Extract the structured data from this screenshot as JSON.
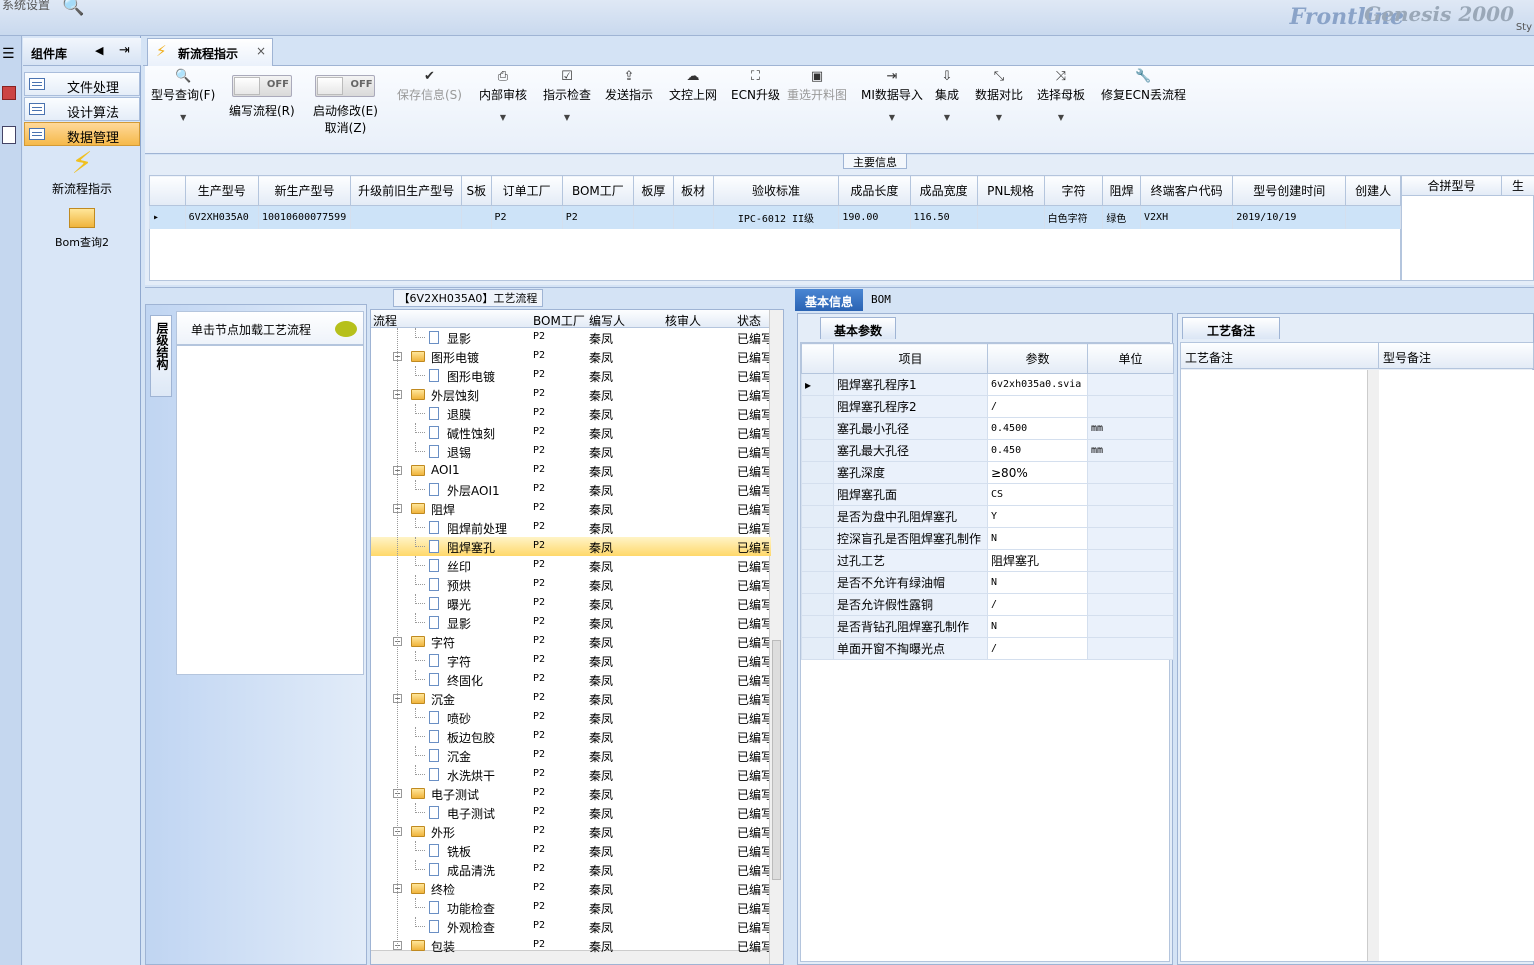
{
  "app": {
    "brand": "Frontline",
    "brand2": "Genesis 2000",
    "topleft": "系统设置",
    "topright": "Sty"
  },
  "complib": {
    "title": "组件库",
    "nav": [
      {
        "label": "文件处理",
        "active": false
      },
      {
        "label": "设计算法",
        "active": false
      },
      {
        "label": "数据管理",
        "active": true
      }
    ],
    "items": [
      {
        "label": "新流程指示",
        "icon": "lightning-icon"
      },
      {
        "label": "Bom查询2",
        "icon": "folder-open-icon"
      }
    ]
  },
  "tab": {
    "label": "新流程指示",
    "close": "×"
  },
  "toolbar": {
    "items": [
      {
        "label": "型号查询(F)",
        "icon": "🔍",
        "dd": true,
        "name": "model-query-button"
      },
      {
        "label": "编写流程(R)",
        "toggle": "OFF",
        "name": "write-flow-toggle"
      },
      {
        "label": "启动修改(E)",
        "label2": "取消(Z)",
        "toggle": "OFF",
        "name": "enable-edit-toggle"
      },
      {
        "label": "保存信息(S)",
        "icon": "✔",
        "disabled": true,
        "name": "save-info-button"
      },
      {
        "label": "内部审核",
        "icon": "⎙",
        "dd": true,
        "name": "internal-review-button"
      },
      {
        "label": "指示检查",
        "icon": "☑",
        "dd": true,
        "name": "instruction-check-button"
      },
      {
        "label": "发送指示",
        "icon": "⇪",
        "name": "send-instruction-button"
      },
      {
        "label": "文控上网",
        "icon": "☁",
        "name": "doc-control-online-button"
      },
      {
        "label": "ECN升级",
        "icon": "⛶",
        "name": "ecn-upgrade-button"
      },
      {
        "label": "重选开料图",
        "icon": "▣",
        "disabled": true,
        "name": "reselect-cutting-button"
      },
      {
        "label": "MI数据导入",
        "icon": "⇥",
        "dd": true,
        "name": "mi-import-button"
      },
      {
        "label": "集成",
        "icon": "⇩",
        "dd": true,
        "name": "integrate-button"
      },
      {
        "label": "数据对比",
        "icon": "⤡",
        "dd": true,
        "name": "data-compare-button"
      },
      {
        "label": "选择母板",
        "icon": "⤨",
        "dd": true,
        "name": "select-motherboard-button"
      },
      {
        "label": "修复ECN丢流程",
        "icon": "🔧",
        "name": "repair-ecn-button"
      }
    ]
  },
  "maininfo": {
    "caption": "主要信息",
    "columns": [
      "生产型号",
      "新生产型号",
      "升级前旧生产型号",
      "S板",
      "订单工厂",
      "BOM工厂",
      "板厚",
      "板材",
      "验收标准",
      "成品长度",
      "成品宽度",
      "PNL规格",
      "字符",
      "阻焊",
      "终端客户代码",
      "型号创建时间",
      "创建人"
    ],
    "row": [
      "6V2XH035A0",
      "10010600077599",
      "",
      "",
      "P2",
      "P2",
      "",
      "",
      "IPC-6012 II级",
      "190.00",
      "116.50",
      "",
      "白色字符",
      "绿色",
      "V2XH",
      "2019/10/19",
      ""
    ],
    "right_columns": [
      "合拼型号",
      "生"
    ]
  },
  "leftpanel": {
    "sidetab": "层级结构",
    "load_label": "单击节点加载工艺流程"
  },
  "tree": {
    "caption": "【6V2XH035A0】工艺流程",
    "columns": [
      "流程",
      "BOM工厂",
      "编写人",
      "核审人",
      "状态"
    ],
    "rows": [
      {
        "level": 2,
        "name": "显影",
        "f": "P2",
        "w": "秦凤",
        "s": "已编写"
      },
      {
        "level": 1,
        "name": "图形电镀",
        "f": "P2",
        "w": "秦凤",
        "s": "已编写"
      },
      {
        "level": 2,
        "name": "图形电镀",
        "f": "P2",
        "w": "秦凤",
        "s": "已编写"
      },
      {
        "level": 1,
        "name": "外层蚀刻",
        "f": "P2",
        "w": "秦凤",
        "s": "已编写"
      },
      {
        "level": 2,
        "name": "退膜",
        "f": "P2",
        "w": "秦凤",
        "s": "已编写"
      },
      {
        "level": 2,
        "name": "碱性蚀刻",
        "f": "P2",
        "w": "秦凤",
        "s": "已编写"
      },
      {
        "level": 2,
        "name": "退锡",
        "f": "P2",
        "w": "秦凤",
        "s": "已编写"
      },
      {
        "level": 1,
        "name": "AOI1",
        "f": "P2",
        "w": "秦凤",
        "s": "已编写"
      },
      {
        "level": 2,
        "name": "外层AOI1",
        "f": "P2",
        "w": "秦凤",
        "s": "已编写"
      },
      {
        "level": 1,
        "name": "阻焊",
        "f": "P2",
        "w": "秦凤",
        "s": "已编写"
      },
      {
        "level": 2,
        "name": "阻焊前处理",
        "f": "P2",
        "w": "秦凤",
        "s": "已编写"
      },
      {
        "level": 2,
        "name": "阻焊塞孔",
        "f": "P2",
        "w": "秦凤",
        "s": "已编写",
        "sel": true
      },
      {
        "level": 2,
        "name": "丝印",
        "f": "P2",
        "w": "秦凤",
        "s": "已编写"
      },
      {
        "level": 2,
        "name": "预烘",
        "f": "P2",
        "w": "秦凤",
        "s": "已编写"
      },
      {
        "level": 2,
        "name": "曝光",
        "f": "P2",
        "w": "秦凤",
        "s": "已编写"
      },
      {
        "level": 2,
        "name": "显影",
        "f": "P2",
        "w": "秦凤",
        "s": "已编写"
      },
      {
        "level": 1,
        "name": "字符",
        "f": "P2",
        "w": "秦凤",
        "s": "已编写"
      },
      {
        "level": 2,
        "name": "字符",
        "f": "P2",
        "w": "秦凤",
        "s": "已编写"
      },
      {
        "level": 2,
        "name": "终固化",
        "f": "P2",
        "w": "秦凤",
        "s": "已编写"
      },
      {
        "level": 1,
        "name": "沉金",
        "f": "P2",
        "w": "秦凤",
        "s": "已编写"
      },
      {
        "level": 2,
        "name": "喷砂",
        "f": "P2",
        "w": "秦凤",
        "s": "已编写"
      },
      {
        "level": 2,
        "name": "板边包胶",
        "f": "P2",
        "w": "秦凤",
        "s": "已编写"
      },
      {
        "level": 2,
        "name": "沉金",
        "f": "P2",
        "w": "秦凤",
        "s": "已编写"
      },
      {
        "level": 2,
        "name": "水洗烘干",
        "f": "P2",
        "w": "秦凤",
        "s": "已编写"
      },
      {
        "level": 1,
        "name": "电子测试",
        "f": "P2",
        "w": "秦凤",
        "s": "已编写"
      },
      {
        "level": 2,
        "name": "电子测试",
        "f": "P2",
        "w": "秦凤",
        "s": "已编写"
      },
      {
        "level": 1,
        "name": "外形",
        "f": "P2",
        "w": "秦凤",
        "s": "已编写"
      },
      {
        "level": 2,
        "name": "铣板",
        "f": "P2",
        "w": "秦凤",
        "s": "已编写"
      },
      {
        "level": 2,
        "name": "成品清洗",
        "f": "P2",
        "w": "秦凤",
        "s": "已编写"
      },
      {
        "level": 1,
        "name": "终检",
        "f": "P2",
        "w": "秦凤",
        "s": "已编写"
      },
      {
        "level": 2,
        "name": "功能检查",
        "f": "P2",
        "w": "秦凤",
        "s": "已编写"
      },
      {
        "level": 2,
        "name": "外观检查",
        "f": "P2",
        "w": "秦凤",
        "s": "已编写"
      },
      {
        "level": 1,
        "name": "包装",
        "f": "P2",
        "w": "秦凤",
        "s": "已编写"
      }
    ]
  },
  "rtabs": {
    "tab1": "基本信息",
    "tab2": "BOM"
  },
  "params": {
    "caption": "基本参数",
    "columns": [
      "项目",
      "参数",
      "单位"
    ],
    "rows": [
      {
        "item": "阻焊塞孔程序1",
        "value": "6v2xh035a0.svia",
        "unit": ""
      },
      {
        "item": "阻焊塞孔程序2",
        "value": "/",
        "unit": ""
      },
      {
        "item": "塞孔最小孔径",
        "value": "0.4500",
        "unit": "mm"
      },
      {
        "item": "塞孔最大孔径",
        "value": "0.450",
        "unit": "mm"
      },
      {
        "item": "塞孔深度",
        "value": "≥80%",
        "unit": ""
      },
      {
        "item": "阻焊塞孔面",
        "value": "CS",
        "unit": ""
      },
      {
        "item": "是否为盘中孔阻焊塞孔",
        "value": "Y",
        "unit": ""
      },
      {
        "item": "控深盲孔是否阻焊塞孔制作",
        "value": "N",
        "unit": ""
      },
      {
        "item": "过孔工艺",
        "value": "阻焊塞孔",
        "unit": ""
      },
      {
        "item": "是否不允许有绿油帽",
        "value": "N",
        "unit": ""
      },
      {
        "item": "是否允许假性露铜",
        "value": "/",
        "unit": ""
      },
      {
        "item": "是否背钻孔阻焊塞孔制作",
        "value": "N",
        "unit": ""
      },
      {
        "item": "单面开窗不掏曝光点",
        "value": "/",
        "unit": ""
      }
    ]
  },
  "notes": {
    "caption": "工艺备注",
    "col1": "工艺备注",
    "col2": "型号备注"
  }
}
